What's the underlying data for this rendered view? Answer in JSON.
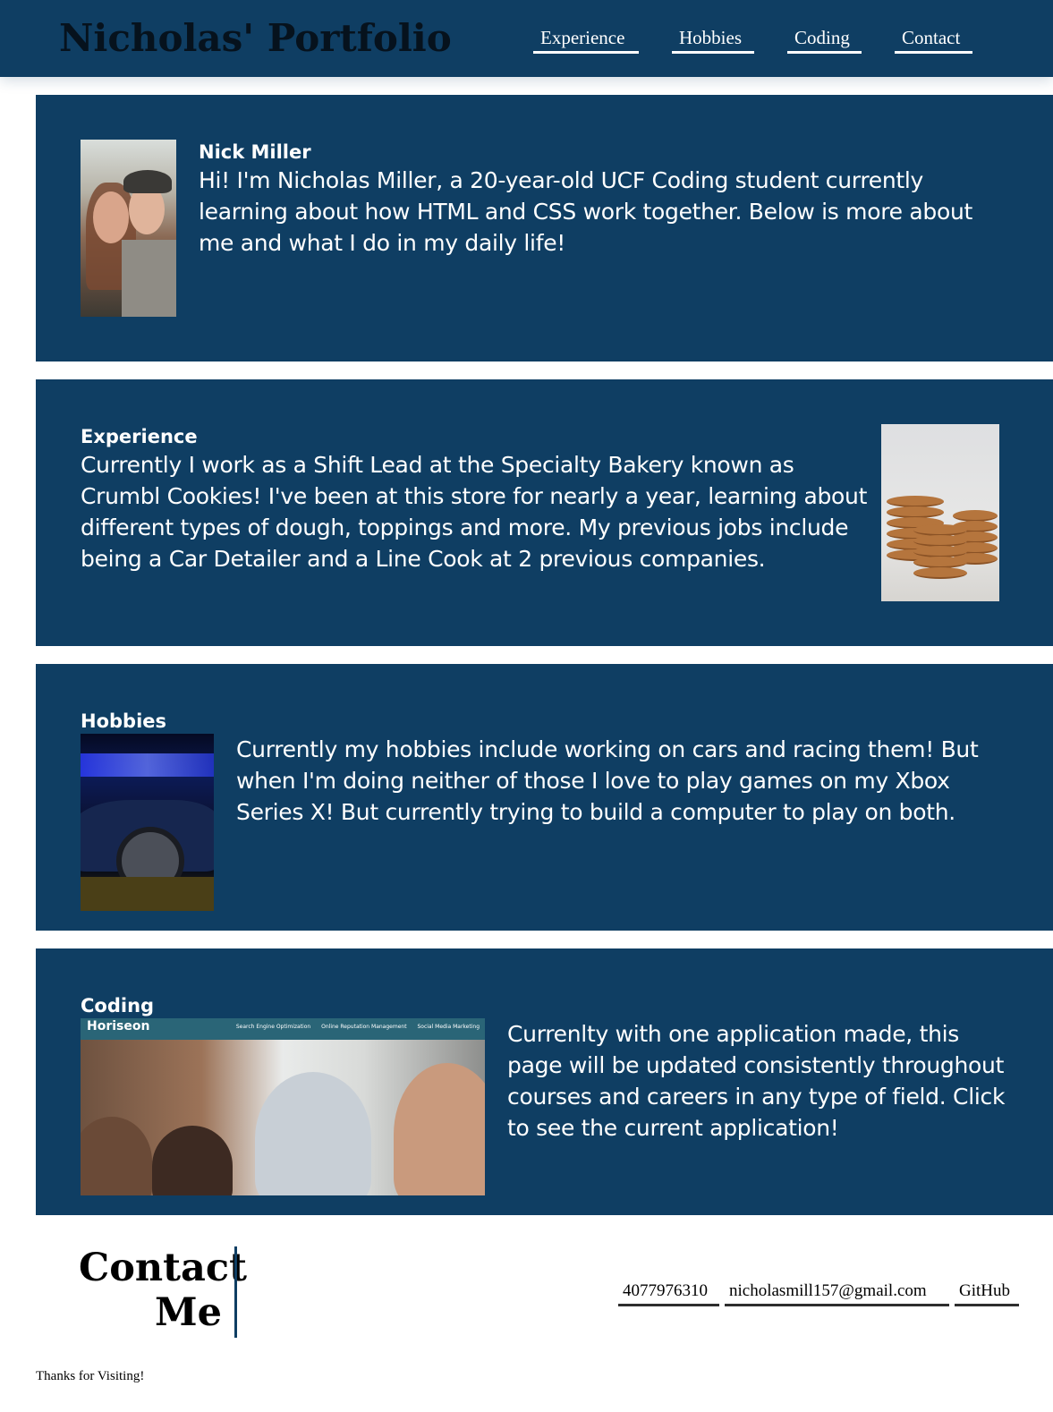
{
  "header": {
    "title": "Nicholas' Portfolio",
    "nav": [
      {
        "label": "Experience"
      },
      {
        "label": "Hobbies"
      },
      {
        "label": "Coding"
      },
      {
        "label": "Contact"
      }
    ]
  },
  "about": {
    "heading": "Nick Miller",
    "text": "Hi! I'm Nicholas Miller, a 20-year-old UCF Coding student currently learning about how HTML and CSS work together. Below is more about me and what I do in my daily life!"
  },
  "experience": {
    "heading": "Experience",
    "text": "Currently I work as a Shift Lead at the Specialty Bakery known as Crumbl Cookies! I've been at this store for nearly a year, learning about different types of dough, toppings and more. My previous jobs include being a Car Detailer and a Line Cook at 2 previous companies."
  },
  "hobbies": {
    "heading": "Hobbies",
    "text": "Currently my hobbies include working on cars and racing them! But when I'm doing neither of those I love to play games on my Xbox Series X! But currently trying to build a computer to play on both."
  },
  "coding": {
    "heading": "Coding",
    "screenshot": {
      "logo": "Horiseon",
      "links": [
        "Search Engine Optimization",
        "Online Reputation Management",
        "Social Media Marketing"
      ]
    },
    "text": "Currenlty with one application made, this page will be updated consistently throughout courses and careers in any type of field. Click to see the current application!"
  },
  "contact": {
    "title_line1": "Contact",
    "title_line2": "Me",
    "phone": "4077976310",
    "email": "nicholasmill157@gmail.com",
    "github": "GitHub"
  },
  "footer": {
    "text": "Thanks for Visiting!"
  },
  "colors": {
    "primary": "#0f3e63",
    "text_light": "#ffffff",
    "title_dark": "#06121d"
  }
}
